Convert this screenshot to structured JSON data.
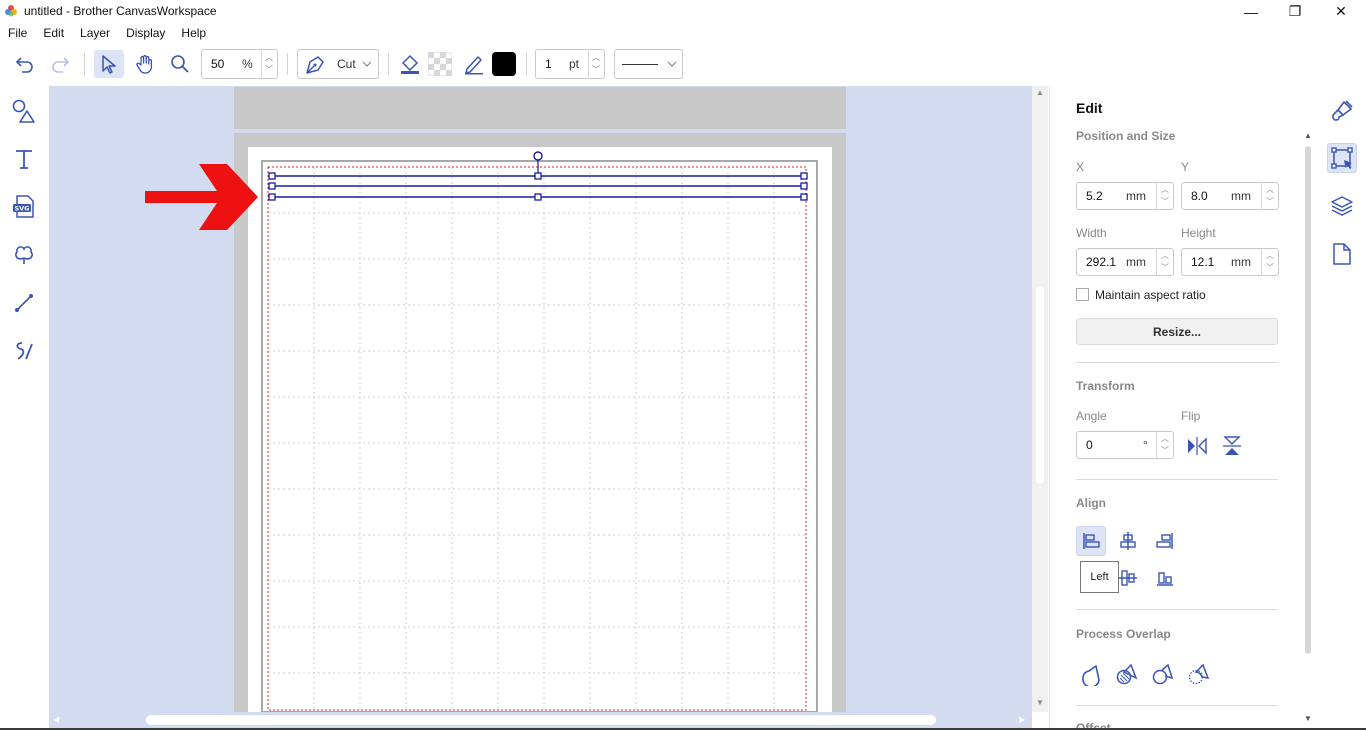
{
  "window": {
    "title": "untitled - Brother CanvasWorkspace",
    "minimize_glyph": "—",
    "restore_glyph": "❐",
    "close_glyph": "✕"
  },
  "menu": [
    "File",
    "Edit",
    "Layer",
    "Display",
    "Help"
  ],
  "toolbar": {
    "zoom_value": "50",
    "zoom_unit": "%",
    "tool_mode": "Cut",
    "line_width_value": "1",
    "line_width_unit": "pt",
    "stroke_color": "#000000"
  },
  "panel": {
    "title": "Edit",
    "position_size": {
      "heading": "Position and Size",
      "x_label": "X",
      "x_value": "5.2",
      "y_label": "Y",
      "y_value": "8.0",
      "width_label": "Width",
      "width_value": "292.1",
      "height_label": "Height",
      "height_value": "12.1",
      "unit": "mm",
      "maintain_aspect_label": "Maintain aspect ratio",
      "maintain_aspect_checked": false,
      "resize_button": "Resize..."
    },
    "transform": {
      "heading": "Transform",
      "angle_label": "Angle",
      "angle_value": "0",
      "angle_unit": "°",
      "flip_label": "Flip"
    },
    "align": {
      "heading": "Align",
      "tooltip": "Left"
    },
    "process_overlap": {
      "heading": "Process Overlap"
    },
    "next_section_partial": "Offset"
  },
  "colors": {
    "accent": "#3b55b7",
    "canvas_bg": "#d3dbf0",
    "selection": "#1a1aa8",
    "arrow": "#ee1111",
    "cut_border": "#e02020"
  }
}
